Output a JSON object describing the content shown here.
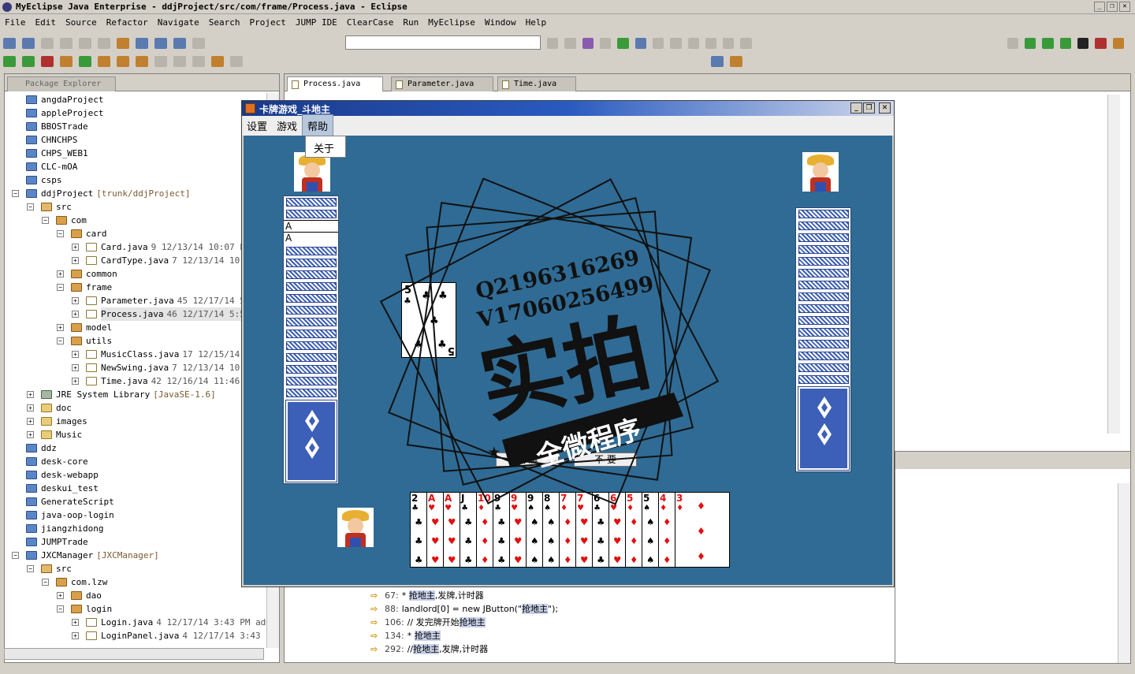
{
  "window": {
    "title": "MyEclipse Java Enterprise - ddjProject/src/com/frame/Process.java - Eclipse",
    "controls": [
      "_",
      "❐",
      "✕"
    ]
  },
  "menu": [
    "File",
    "Edit",
    "Source",
    "Refactor",
    "Navigate",
    "Search",
    "Project",
    "JUMP IDE",
    "ClearCase",
    "Run",
    "MyEclipse",
    "Window",
    "Help"
  ],
  "package_explorer": {
    "tab_label": "Package Explorer",
    "rows": [
      {
        "label": "angdaProject",
        "meta": "",
        "icon": "project-icon"
      },
      {
        "label": "appleProject",
        "meta": "",
        "icon": "project-icon"
      },
      {
        "label": "BBOSTrade",
        "meta": "",
        "icon": "project-icon"
      },
      {
        "label": "CHNCHPS",
        "meta": "",
        "icon": "project-icon"
      },
      {
        "label": "CHPS_WEB1",
        "meta": "",
        "icon": "project-icon"
      },
      {
        "label": "CLC-mOA",
        "meta": "",
        "icon": "project-icon"
      },
      {
        "label": "csps",
        "meta": "",
        "icon": "project-icon"
      },
      {
        "label": "ddjProject",
        "meta": "[trunk/ddjProject]",
        "icon": "project-icon"
      },
      {
        "label": "src",
        "meta": "",
        "icon": "source-folder-icon"
      },
      {
        "label": "com",
        "meta": "",
        "icon": "package-icon"
      },
      {
        "label": "card",
        "meta": "",
        "icon": "package-icon"
      },
      {
        "label": "Card.java",
        "meta": "9   12/13/14 10:07 PM",
        "icon": "java-file-icon"
      },
      {
        "label": "CardType.java",
        "meta": "7   12/13/14 10:0",
        "icon": "java-file-icon"
      },
      {
        "label": "common",
        "meta": "",
        "icon": "package-icon"
      },
      {
        "label": "frame",
        "meta": "",
        "icon": "package-icon"
      },
      {
        "label": "Parameter.java",
        "meta": "45   12/17/14 5:",
        "icon": "java-file-icon"
      },
      {
        "label": "Process.java",
        "meta": "46   12/17/14 5:59",
        "icon": "java-file-icon"
      },
      {
        "label": "model",
        "meta": "",
        "icon": "package-icon"
      },
      {
        "label": "utils",
        "meta": "",
        "icon": "package-icon"
      },
      {
        "label": "MusicClass.java",
        "meta": "17   12/15/14 1",
        "icon": "java-file-icon"
      },
      {
        "label": "NewSwing.java",
        "meta": "7   12/13/14 10:0",
        "icon": "java-file-icon"
      },
      {
        "label": "Time.java",
        "meta": "42   12/16/14 11:46 P",
        "icon": "java-file-icon"
      },
      {
        "label": "JRE System Library",
        "meta": "[JavaSE-1.6]",
        "icon": "library-icon"
      },
      {
        "label": "doc",
        "meta": "",
        "icon": "folder-icon"
      },
      {
        "label": "images",
        "meta": "",
        "icon": "folder-icon"
      },
      {
        "label": "Music",
        "meta": "",
        "icon": "folder-icon"
      },
      {
        "label": "ddz",
        "meta": "",
        "icon": "project-icon"
      },
      {
        "label": "desk-core",
        "meta": "",
        "icon": "project-icon"
      },
      {
        "label": "desk-webapp",
        "meta": "",
        "icon": "project-icon"
      },
      {
        "label": "deskui_test",
        "meta": "",
        "icon": "project-icon"
      },
      {
        "label": "GenerateScript",
        "meta": "",
        "icon": "project-icon"
      },
      {
        "label": "java-oop-login",
        "meta": "",
        "icon": "project-icon"
      },
      {
        "label": "jiangzhidong",
        "meta": "",
        "icon": "project-icon"
      },
      {
        "label": "JUMPTrade",
        "meta": "",
        "icon": "project-icon"
      },
      {
        "label": "JXCManager",
        "meta": "[JXCManager]",
        "icon": "project-icon"
      },
      {
        "label": "src",
        "meta": "",
        "icon": "source-folder-icon"
      },
      {
        "label": "com.lzw",
        "meta": "",
        "icon": "package-icon"
      },
      {
        "label": "dao",
        "meta": "",
        "icon": "package-icon"
      },
      {
        "label": "login",
        "meta": "",
        "icon": "package-icon"
      },
      {
        "label": "Login.java",
        "meta": "4   12/17/14 3:43 PM   admi",
        "icon": "java-file-icon"
      },
      {
        "label": "LoginPanel.java",
        "meta": "4   12/17/14 3:43 PM",
        "icon": "java-file-icon"
      }
    ]
  },
  "editor": {
    "tabs": [
      "Process.java",
      "Parameter.java",
      "Time.java"
    ],
    "active_tab": 0
  },
  "search_results": [
    {
      "line": "67:",
      "pre": "* ",
      "hl": "抢地主",
      "post": ",发牌,计时器"
    },
    {
      "line": "88:",
      "pre": "landlord[0] = new JButton(\"",
      "hl": "抢地主",
      "post": "\");"
    },
    {
      "line": "106:",
      "pre": "// 发完牌开始",
      "hl": "抢地主",
      "post": ""
    },
    {
      "line": "134:",
      "pre": "* ",
      "hl": "抢地主",
      "post": ""
    },
    {
      "line": "292:",
      "pre": "//",
      "hl": "抢地主",
      "post": ",发牌,计时器"
    }
  ],
  "game": {
    "title": "卡牌游戏_斗地主",
    "menu": [
      "设置",
      "游戏",
      "帮助"
    ],
    "active_menu": 2,
    "dropdown_item": "关于",
    "buttons": {
      "play": "出  牌",
      "pass": "不  要"
    },
    "played_card": {
      "rank": "5",
      "suit": "♣"
    },
    "left_face_cards": [
      "A",
      "A"
    ],
    "left_back_count": 15,
    "right_back_count": 15,
    "hand": [
      {
        "rank": "2",
        "suit": "♣",
        "color": "black"
      },
      {
        "rank": "A",
        "suit": "♥",
        "color": "red"
      },
      {
        "rank": "A",
        "suit": "♥",
        "color": "red"
      },
      {
        "rank": "J",
        "suit": "♣",
        "color": "black"
      },
      {
        "rank": "10",
        "suit": "♦",
        "color": "red"
      },
      {
        "rank": "9",
        "suit": "♣",
        "color": "black"
      },
      {
        "rank": "9",
        "suit": "♥",
        "color": "red"
      },
      {
        "rank": "9",
        "suit": "♠",
        "color": "black"
      },
      {
        "rank": "8",
        "suit": "♠",
        "color": "black"
      },
      {
        "rank": "7",
        "suit": "♦",
        "color": "red"
      },
      {
        "rank": "7",
        "suit": "♥",
        "color": "red"
      },
      {
        "rank": "6",
        "suit": "♣",
        "color": "black"
      },
      {
        "rank": "6",
        "suit": "♥",
        "color": "red"
      },
      {
        "rank": "5",
        "suit": "♦",
        "color": "red"
      },
      {
        "rank": "5",
        "suit": "♠",
        "color": "black"
      },
      {
        "rank": "4",
        "suit": "♦",
        "color": "red"
      },
      {
        "rank": "3",
        "suit": "♦",
        "color": "red"
      }
    ],
    "table_color": "#2f6b94"
  },
  "watermark": {
    "line1": "Q2196316269",
    "line2": "V17060256499",
    "big": "实拍",
    "banner": "全微程序"
  }
}
